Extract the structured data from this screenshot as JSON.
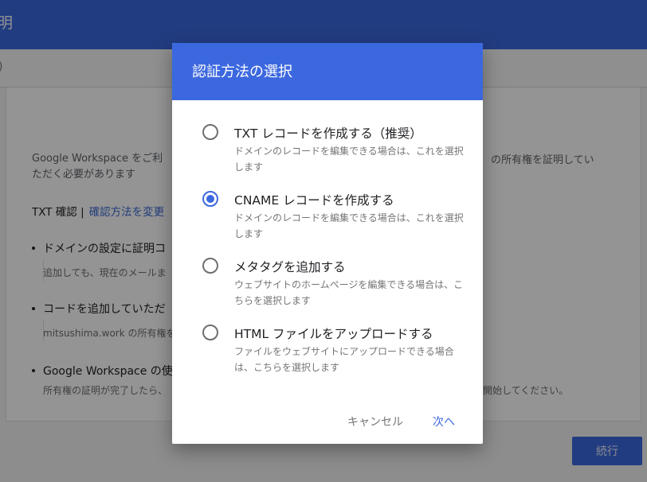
{
  "page": {
    "topbar_title": "明",
    "subbar_text": ")",
    "intro_line1": "Google Workspace をご利",
    "intro_line2": "ただく必要があります",
    "intro_right": "の所有権を証明してい",
    "txt_label": "TXT 確認 |",
    "change_link": "確認方法を変更",
    "bullet1": "ドメインの設定に証明コ",
    "note1": "追加しても、現在のメールま",
    "bullet2": "コードを追加していただ",
    "note2": "mitsushima.work の所有権を",
    "bullet3": "Google Workspace の使",
    "tail_note": "所有権の証明が完了したら、",
    "tail_right": "開始してください。",
    "continue_label": "続行"
  },
  "dialog": {
    "title": "認証方法の選択",
    "options": [
      {
        "label": "TXT レコードを作成する（推奨）",
        "desc": "ドメインのレコードを編集できる場合は、これを選択します",
        "checked": false
      },
      {
        "label": "CNAME レコードを作成する",
        "desc": "ドメインのレコードを編集できる場合は、これを選択します",
        "checked": true
      },
      {
        "label": "メタタグを追加する",
        "desc": "ウェブサイトのホームページを編集できる場合は、こちらを選択します",
        "checked": false
      },
      {
        "label": "HTML ファイルをアップロードする",
        "desc": "ファイルをウェブサイトにアップロードできる場合は、こちらを選択します",
        "checked": false
      }
    ],
    "cancel_label": "キャンセル",
    "next_label": "次へ"
  },
  "colors": {
    "accent": "#3c68df"
  }
}
